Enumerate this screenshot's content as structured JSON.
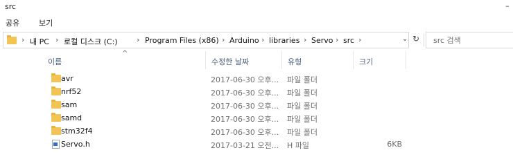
{
  "window": {
    "title": "src",
    "control_glyph": "–"
  },
  "ribbon": {
    "tabs": [
      "공유",
      "보기"
    ]
  },
  "address": {
    "crumbs": [
      "내 PC",
      "로컬 디스크 (C:)",
      "Program Files (x86)",
      "Arduino",
      "libraries",
      "Servo",
      "src"
    ],
    "separator": "›",
    "dropdown_glyph": "⌄",
    "refresh_glyph": "↻"
  },
  "search": {
    "placeholder": "src 검색"
  },
  "columns": {
    "name": "이름",
    "date": "수정한 날짜",
    "type": "유형",
    "size": "크기",
    "sort_glyph": "^"
  },
  "items": [
    {
      "name": "avr",
      "date": "2017-06-30 오후...",
      "type": "파일 폴더",
      "size": "",
      "icon": "folder-icon"
    },
    {
      "name": "nrf52",
      "date": "2017-06-30 오후...",
      "type": "파일 폴더",
      "size": "",
      "icon": "folder-icon"
    },
    {
      "name": "sam",
      "date": "2017-06-30 오후...",
      "type": "파일 폴더",
      "size": "",
      "icon": "folder-icon"
    },
    {
      "name": "samd",
      "date": "2017-06-30 오후...",
      "type": "파일 폴더",
      "size": "",
      "icon": "folder-icon"
    },
    {
      "name": "stm32f4",
      "date": "2017-06-30 오후...",
      "type": "파일 폴더",
      "size": "",
      "icon": "folder-icon"
    },
    {
      "name": "Servo.h",
      "date": "2017-03-21 오전...",
      "type": "H 파일",
      "size": "6KB",
      "icon": "h-file-icon"
    }
  ],
  "colors": {
    "folder": "#f2c455",
    "header_text": "#4c607a",
    "muted_text": "#6d6d6d"
  }
}
